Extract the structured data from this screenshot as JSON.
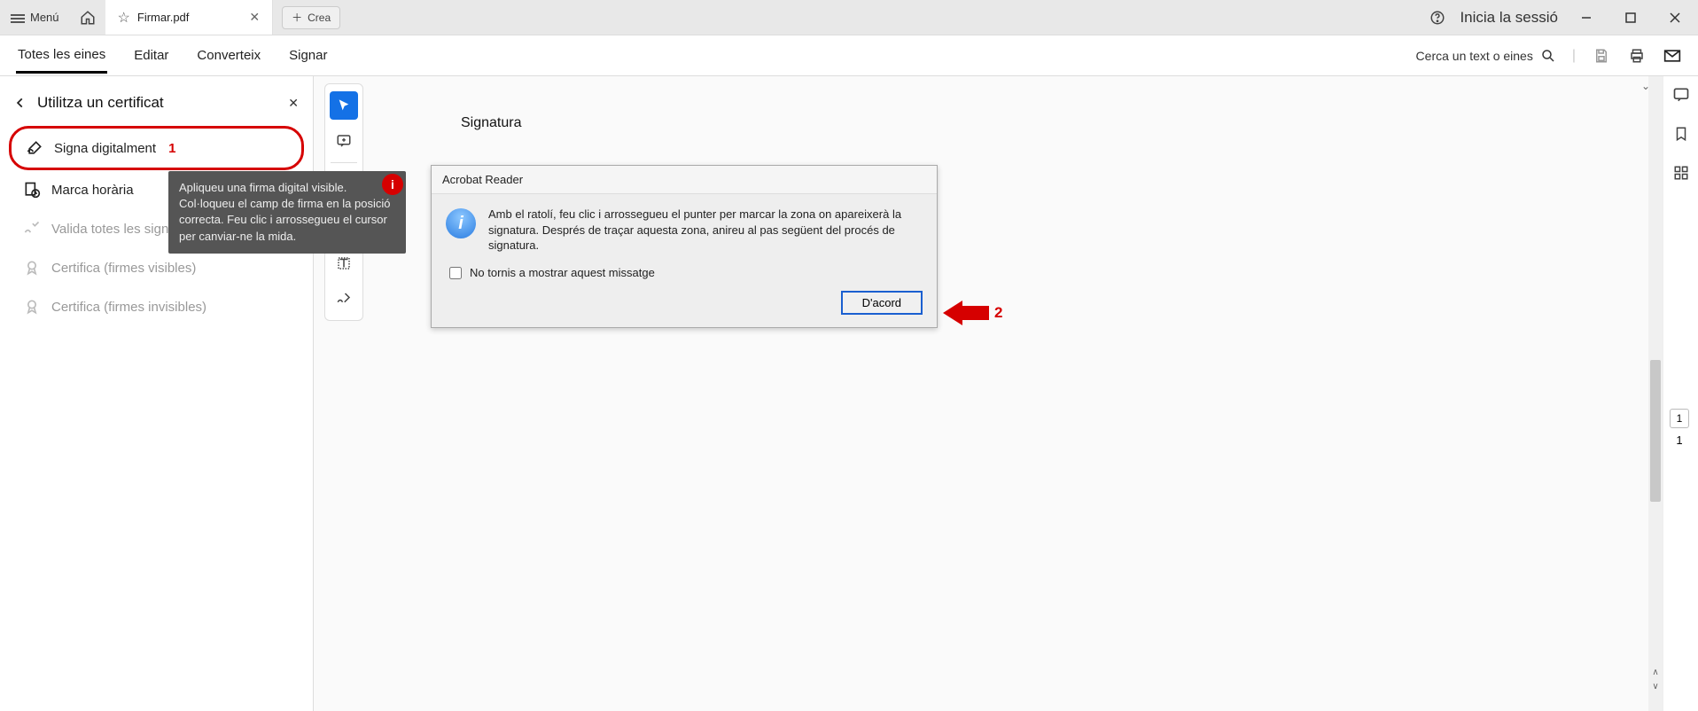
{
  "topbar": {
    "menu_label": "Menú",
    "tab_title": "Firmar.pdf",
    "crea_label": "Crea",
    "signin_label": "Inicia la sessió"
  },
  "menubar": {
    "items": [
      "Totes les eines",
      "Editar",
      "Converteix",
      "Signar"
    ],
    "search_placeholder": "Cerca un text o eines"
  },
  "sidebar": {
    "title": "Utilitza un certificat",
    "items": [
      {
        "label": "Signa digitalment"
      },
      {
        "label": "Marca horària"
      },
      {
        "label": "Valida totes les signatures"
      },
      {
        "label": "Certifica (firmes visibles)"
      },
      {
        "label": "Certifica (firmes invisibles)"
      }
    ]
  },
  "tooltip": {
    "text": "Apliqueu una firma digital visible. Col·loqueu el camp de firma en la posició correcta. Feu clic i arrossegueu el cursor per canviar-ne la mida."
  },
  "annotations": {
    "num1": "1",
    "num2": "2",
    "info": "i"
  },
  "doc": {
    "signature_heading": "Signatura"
  },
  "dialog": {
    "title": "Acrobat Reader",
    "message": "Amb el ratolí, feu clic i arrossegueu el punter per marcar la zona on apareixerà la signatura. Després de traçar aquesta zona, anireu al pas següent del procés de signatura.",
    "checkbox_label": "No tornis a mostrar aquest missatge",
    "ok_label": "D'acord"
  },
  "pager": {
    "current": "1",
    "total": "1"
  }
}
